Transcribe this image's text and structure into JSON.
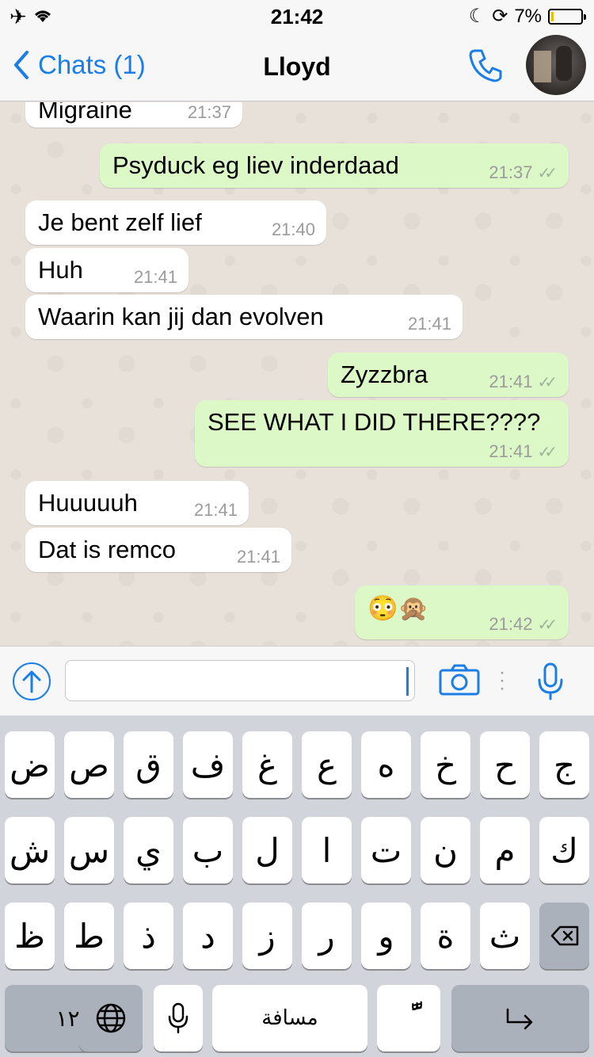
{
  "status": {
    "time": "21:42",
    "battery": "7%",
    "battery_level": 0.07,
    "left_icons": [
      "airplane-icon",
      "wifi-icon"
    ],
    "right_icons": [
      "moon-icon",
      "orientation-lock-icon",
      "battery-icon"
    ]
  },
  "nav": {
    "back_label": "Chats (1)",
    "title": "Lloyd",
    "icons": [
      "chevron-left-icon",
      "phone-icon",
      "avatar"
    ]
  },
  "messages": [
    {
      "dir": "in",
      "text": "Migraine",
      "time": "21:37"
    },
    {
      "dir": "out",
      "text": "Psyduck eg liev inderdaad",
      "time": "21:37",
      "ticks": "✓✓"
    },
    {
      "dir": "in",
      "text": "Je bent zelf lief",
      "time": "21:40"
    },
    {
      "dir": "in",
      "text": "Huh",
      "time": "21:41"
    },
    {
      "dir": "in",
      "text": "Waarin kan jij dan evolven",
      "time": "21:41"
    },
    {
      "dir": "out",
      "text": "Zyzzbra",
      "time": "21:41",
      "ticks": "✓✓"
    },
    {
      "dir": "out",
      "text": "SEE WHAT I DID THERE????",
      "time": "21:41",
      "ticks": "✓✓"
    },
    {
      "dir": "in",
      "text": "Huuuuuh",
      "time": "21:41"
    },
    {
      "dir": "in",
      "text": "Dat is remco",
      "time": "21:41"
    },
    {
      "dir": "out",
      "text": "😳🙊",
      "time": "21:42",
      "ticks": "✓✓"
    }
  ],
  "input": {
    "value": "",
    "icons": [
      "upload-icon",
      "camera-icon",
      "more-icon",
      "microphone-icon"
    ]
  },
  "keyboard": {
    "row1": [
      "ض",
      "ص",
      "ق",
      "ف",
      "غ",
      "ع",
      "ه",
      "خ",
      "ح",
      "ج"
    ],
    "row2": [
      "ش",
      "س",
      "ي",
      "ب",
      "ل",
      "ا",
      "ت",
      "ن",
      "م",
      "ك"
    ],
    "row3": [
      "ظ",
      "ط",
      "ذ",
      "د",
      "ز",
      "ر",
      "و",
      "ة",
      "ث"
    ],
    "numbers_key": "١٢٣",
    "space_key": "مسافة",
    "tanween_key": "ًّ",
    "icons": [
      "backspace-icon",
      "globe-icon",
      "microphone-icon",
      "return-icon"
    ]
  },
  "colors": {
    "accent": "#1a7ee6",
    "incoming": "#ffffff",
    "outgoing": "#dcf8c6",
    "chat_bg": "#e8e1d9"
  }
}
